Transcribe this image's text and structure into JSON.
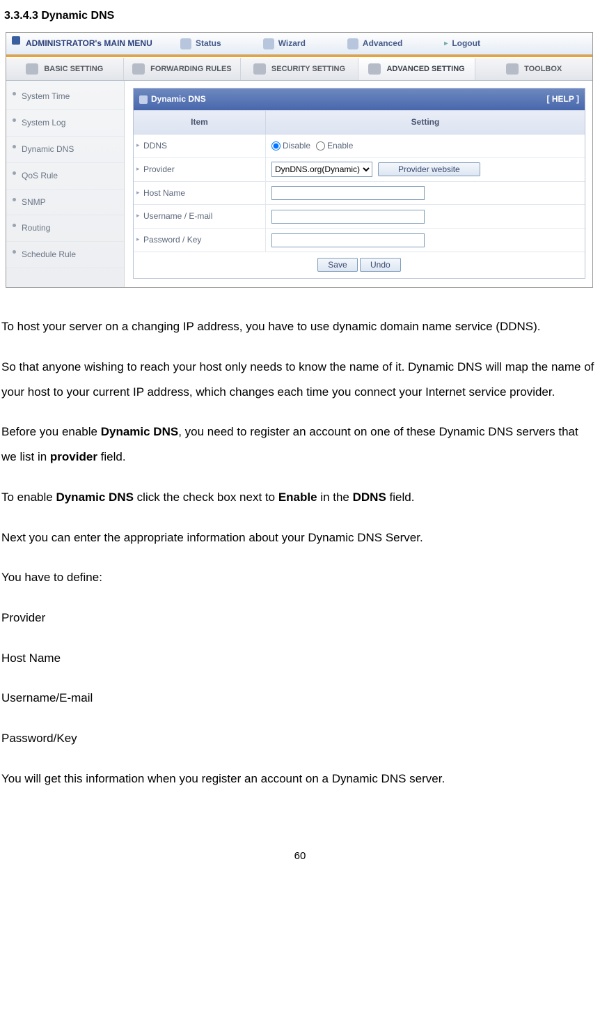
{
  "section_heading": "3.3.4.3 Dynamic DNS",
  "topbar": {
    "admin": "ADMINISTRATOR's MAIN MENU",
    "items": [
      "Status",
      "Wizard",
      "Advanced",
      "Logout"
    ]
  },
  "tabs": [
    "BASIC SETTING",
    "FORWARDING RULES",
    "SECURITY SETTING",
    "ADVANCED SETTING",
    "TOOLBOX"
  ],
  "sidebar": [
    "System Time",
    "System Log",
    "Dynamic DNS",
    "QoS Rule",
    "SNMP",
    "Routing",
    "Schedule Rule"
  ],
  "panel": {
    "title": "Dynamic DNS",
    "help": "[ HELP ]",
    "colhead_item": "Item",
    "colhead_setting": "Setting",
    "rows": {
      "ddns": "DDNS",
      "ddns_disable": "Disable",
      "ddns_enable": "Enable",
      "provider": "Provider",
      "provider_sel": "DynDNS.org(Dynamic)",
      "provider_btn": "Provider website",
      "hostname": "Host Name",
      "username": "Username / E-mail",
      "password": "Password / Key"
    },
    "save": "Save",
    "undo": "Undo"
  },
  "doc": {
    "p1": "To host your server on a changing IP address, you have to use dynamic domain name service (DDNS).",
    "p2": "So that anyone wishing to reach your host only needs to know the name of it. Dynamic DNS will map the name of your host to your current IP address, which changes each time you connect your Internet service provider.",
    "p3a": "Before you enable ",
    "p3b": "Dynamic DNS",
    "p3c": ", you need to register an account on one of these Dynamic DNS servers that we list in ",
    "p3d": "provider",
    "p3e": " field.",
    "p4a": "To enable ",
    "p4b": "Dynamic DNS",
    "p4c": " click the check box next to ",
    "p4d": "Enable",
    "p4e": " in the ",
    "p4f": "DDNS",
    "p4g": " field.",
    "p5": "Next you can enter the appropriate information about your Dynamic DNS Server.",
    "p6": "You have to define:",
    "l1": "Provider",
    "l2": "Host Name",
    "l3": "Username/E-mail",
    "l4": "Password/Key",
    "p7": "You will get this information when you register an account on a Dynamic DNS server."
  },
  "page_num": "60"
}
